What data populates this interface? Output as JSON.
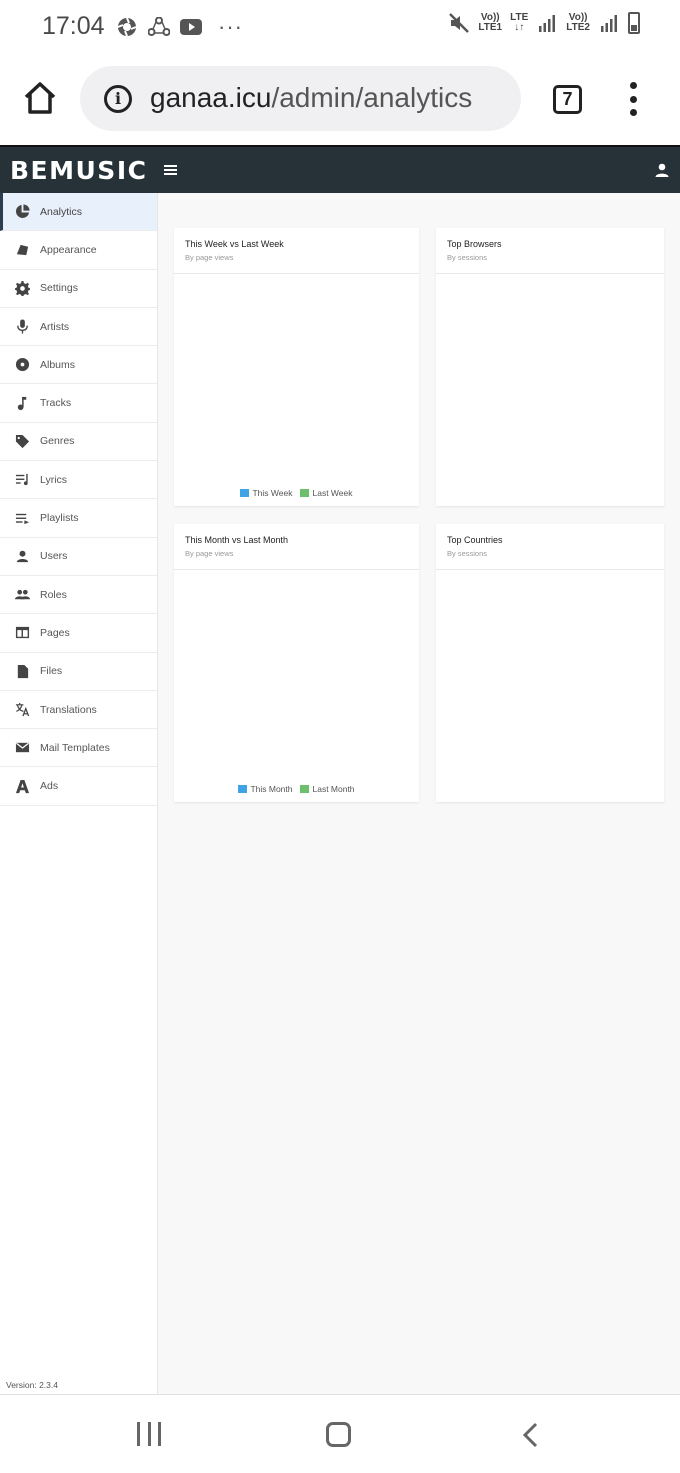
{
  "status_bar": {
    "time": "17:04",
    "more": "···",
    "sim1_top": "Vo))",
    "sim1_bottom": "LTE1",
    "lte_top": "LTE",
    "lte_bottom": "↓↑",
    "sim2_top": "Vo))",
    "sim2_bottom": "LTE2"
  },
  "browser": {
    "url_host": "ganaa.icu",
    "url_path": "/admin/analytics",
    "tab_count": "7"
  },
  "app": {
    "brand": "BEMUSIC"
  },
  "sidebar": {
    "items": [
      {
        "label": "Analytics",
        "icon": "pie-chart-icon",
        "active": true
      },
      {
        "label": "Appearance",
        "icon": "palette-icon"
      },
      {
        "label": "Settings",
        "icon": "gear-icon"
      },
      {
        "label": "Artists",
        "icon": "microphone-icon"
      },
      {
        "label": "Albums",
        "icon": "album-icon"
      },
      {
        "label": "Tracks",
        "icon": "music-note-icon"
      },
      {
        "label": "Genres",
        "icon": "tag-icon"
      },
      {
        "label": "Lyrics",
        "icon": "lyrics-icon"
      },
      {
        "label": "Playlists",
        "icon": "playlist-icon"
      },
      {
        "label": "Users",
        "icon": "user-icon"
      },
      {
        "label": "Roles",
        "icon": "people-icon"
      },
      {
        "label": "Pages",
        "icon": "page-icon"
      },
      {
        "label": "Files",
        "icon": "file-icon"
      },
      {
        "label": "Translations",
        "icon": "translate-icon"
      },
      {
        "label": "Mail Templates",
        "icon": "mail-icon"
      },
      {
        "label": "Ads",
        "icon": "ads-icon"
      }
    ],
    "version": "Version: 2.3.4"
  },
  "cards": {
    "week": {
      "title": "This Week vs Last Week",
      "subtitle": "By page views",
      "legend": [
        "This Week",
        "Last Week"
      ]
    },
    "browsers": {
      "title": "Top Browsers",
      "subtitle": "By sessions"
    },
    "month": {
      "title": "This Month vs Last Month",
      "subtitle": "By page views",
      "legend": [
        "This Month",
        "Last Month"
      ]
    },
    "countries": {
      "title": "Top Countries",
      "subtitle": "By sessions"
    }
  },
  "colors": {
    "current_series": "#3fa3e6",
    "previous_series": "#6cbf6c",
    "header_bg": "#263238"
  }
}
